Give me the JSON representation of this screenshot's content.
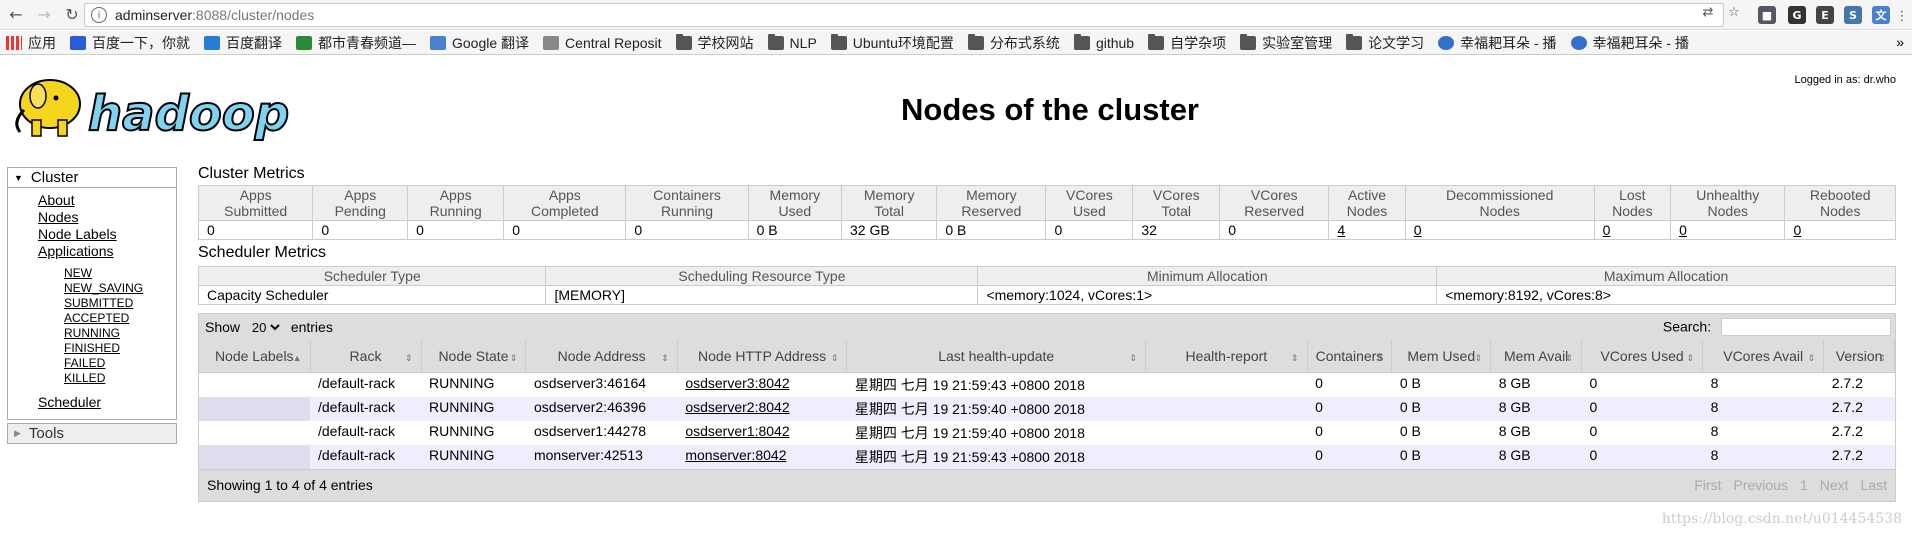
{
  "browser": {
    "url_host": "adminserver",
    "url_rest": ":8088/cluster/nodes",
    "bookmarks": [
      {
        "label": "应用",
        "icon": "apps"
      },
      {
        "label": "百度一下，你就",
        "icon": "paw"
      },
      {
        "label": "百度翻译",
        "icon": "translate"
      },
      {
        "label": "都市青春频道—",
        "icon": "leaf"
      },
      {
        "label": "Google 翻译",
        "icon": "google-translate"
      },
      {
        "label": "Central Reposit",
        "icon": "page"
      },
      {
        "label": "学校网站",
        "icon": "folder"
      },
      {
        "label": "NLP",
        "icon": "folder"
      },
      {
        "label": "Ubuntu环境配置",
        "icon": "folder"
      },
      {
        "label": "分布式系统",
        "icon": "folder"
      },
      {
        "label": "github",
        "icon": "folder"
      },
      {
        "label": "自学杂项",
        "icon": "folder"
      },
      {
        "label": "实验室管理",
        "icon": "folder"
      },
      {
        "label": "论文学习",
        "icon": "folder"
      },
      {
        "label": "幸福耙耳朵 - 播",
        "icon": "play"
      },
      {
        "label": "幸福耙耳朵 - 播",
        "icon": "play"
      }
    ],
    "more": "»"
  },
  "header": {
    "logged_in": "Logged in as: dr.who",
    "logo_text": "hadoop",
    "title": "Nodes of the cluster"
  },
  "sidebar": {
    "cluster": "Cluster",
    "links": [
      "About",
      "Nodes",
      "Node Labels",
      "Applications"
    ],
    "app_states": [
      "NEW",
      "NEW_SAVING",
      "SUBMITTED",
      "ACCEPTED",
      "RUNNING",
      "FINISHED",
      "FAILED",
      "KILLED"
    ],
    "scheduler": "Scheduler",
    "tools": "Tools"
  },
  "cluster_metrics": {
    "title": "Cluster Metrics",
    "headers": [
      [
        "Apps",
        "Submitted"
      ],
      [
        "Apps",
        "Pending"
      ],
      [
        "Apps",
        "Running"
      ],
      [
        "Apps",
        "Completed"
      ],
      [
        "Containers",
        "Running"
      ],
      [
        "Memory",
        "Used"
      ],
      [
        "Memory",
        "Total"
      ],
      [
        "Memory",
        "Reserved"
      ],
      [
        "VCores",
        "Used"
      ],
      [
        "VCores",
        "Total"
      ],
      [
        "VCores",
        "Reserved"
      ],
      [
        "Active",
        "Nodes"
      ],
      [
        "Decommissioned",
        "Nodes"
      ],
      [
        "Lost",
        "Nodes"
      ],
      [
        "Unhealthy",
        "Nodes"
      ],
      [
        "Rebooted",
        "Nodes"
      ]
    ],
    "values": [
      "0",
      "0",
      "0",
      "0",
      "0",
      "0 B",
      "32 GB",
      "0 B",
      "0",
      "32",
      "0",
      "4",
      "0",
      "0",
      "0",
      "0"
    ]
  },
  "scheduler_metrics": {
    "title": "Scheduler Metrics",
    "headers": [
      "Scheduler Type",
      "Scheduling Resource Type",
      "Minimum Allocation",
      "Maximum Allocation"
    ],
    "values": [
      "Capacity Scheduler",
      "[MEMORY]",
      "<memory:1024, vCores:1>",
      "<memory:8192, vCores:8>"
    ]
  },
  "nodes_table": {
    "show": "Show",
    "entries_count": "20",
    "entries": "entries",
    "search_label": "Search:",
    "headers": [
      "Node Labels",
      "Rack",
      "Node State",
      "Node Address",
      "Node HTTP Address",
      "Last health-update",
      "Health-report",
      "Containers",
      "Mem Used",
      "Mem Avail",
      "VCores Used",
      "VCores Avail",
      "Version"
    ],
    "rows": [
      [
        "",
        "/default-rack",
        "RUNNING",
        "osdserver3:46164",
        "osdserver3:8042",
        "星期四 七月 19 21:59:43 +0800 2018",
        "",
        "0",
        "0 B",
        "8 GB",
        "0",
        "8",
        "2.7.2"
      ],
      [
        "",
        "/default-rack",
        "RUNNING",
        "osdserver2:46396",
        "osdserver2:8042",
        "星期四 七月 19 21:59:40 +0800 2018",
        "",
        "0",
        "0 B",
        "8 GB",
        "0",
        "8",
        "2.7.2"
      ],
      [
        "",
        "/default-rack",
        "RUNNING",
        "osdserver1:44278",
        "osdserver1:8042",
        "星期四 七月 19 21:59:40 +0800 2018",
        "",
        "0",
        "0 B",
        "8 GB",
        "0",
        "8",
        "2.7.2"
      ],
      [
        "",
        "/default-rack",
        "RUNNING",
        "monserver:42513",
        "monserver:8042",
        "星期四 七月 19 21:59:43 +0800 2018",
        "",
        "0",
        "0 B",
        "8 GB",
        "0",
        "8",
        "2.7.2"
      ]
    ],
    "info": "Showing 1 to 4 of 4 entries",
    "pager": [
      "First",
      "Previous",
      "1",
      "Next",
      "Last"
    ]
  },
  "watermark": "https://blog.csdn.net/u014454538"
}
